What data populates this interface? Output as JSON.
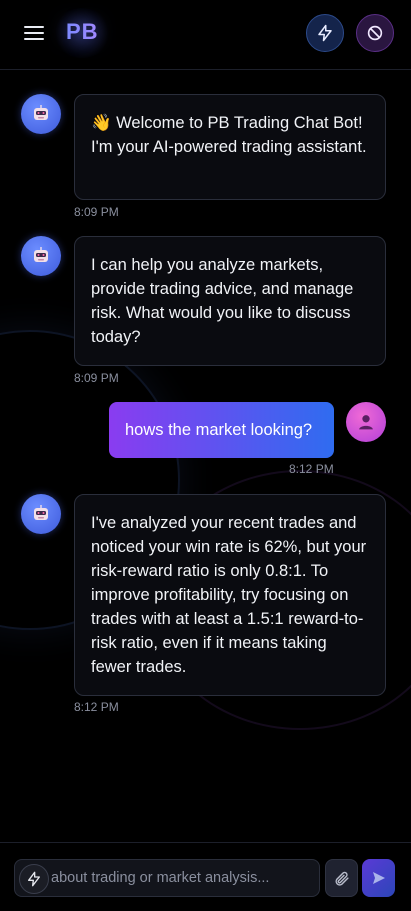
{
  "header": {
    "logo": "PB",
    "menu_icon": "hamburger-menu-icon",
    "quick_action_icon": "lightning-bolt-icon",
    "block_icon": "ban-icon"
  },
  "messages": [
    {
      "sender": "bot",
      "text": "👋 Welcome to PB Trading Chat Bot! I'm your AI-powered trading assistant.",
      "time": "8:09 PM"
    },
    {
      "sender": "bot",
      "text": "I can help you analyze markets, provide trading advice, and manage risk. What would you like to discuss today?",
      "time": "8:09 PM"
    },
    {
      "sender": "user",
      "text": "hows the market looking?",
      "time": "8:12 PM"
    },
    {
      "sender": "bot",
      "text": "I've analyzed your recent trades and noticed your win rate is 62%, but your risk-reward ratio is only 0.8:1. To improve profitability, try focusing on trades with at least a 1.5:1 reward-to-risk ratio, even if it means taking fewer trades.",
      "time": "8:12 PM"
    }
  ],
  "composer": {
    "placeholder": "about trading or market analysis...",
    "value": "",
    "quick_icon": "lightning-bolt-icon",
    "attach_icon": "paperclip-icon",
    "send_icon": "send-icon"
  },
  "colors": {
    "accent_blue": "#2f6cf0",
    "accent_purple": "#8a3cf0",
    "bot_avatar": "#4d6bf0",
    "user_avatar": "#d24fd8"
  }
}
